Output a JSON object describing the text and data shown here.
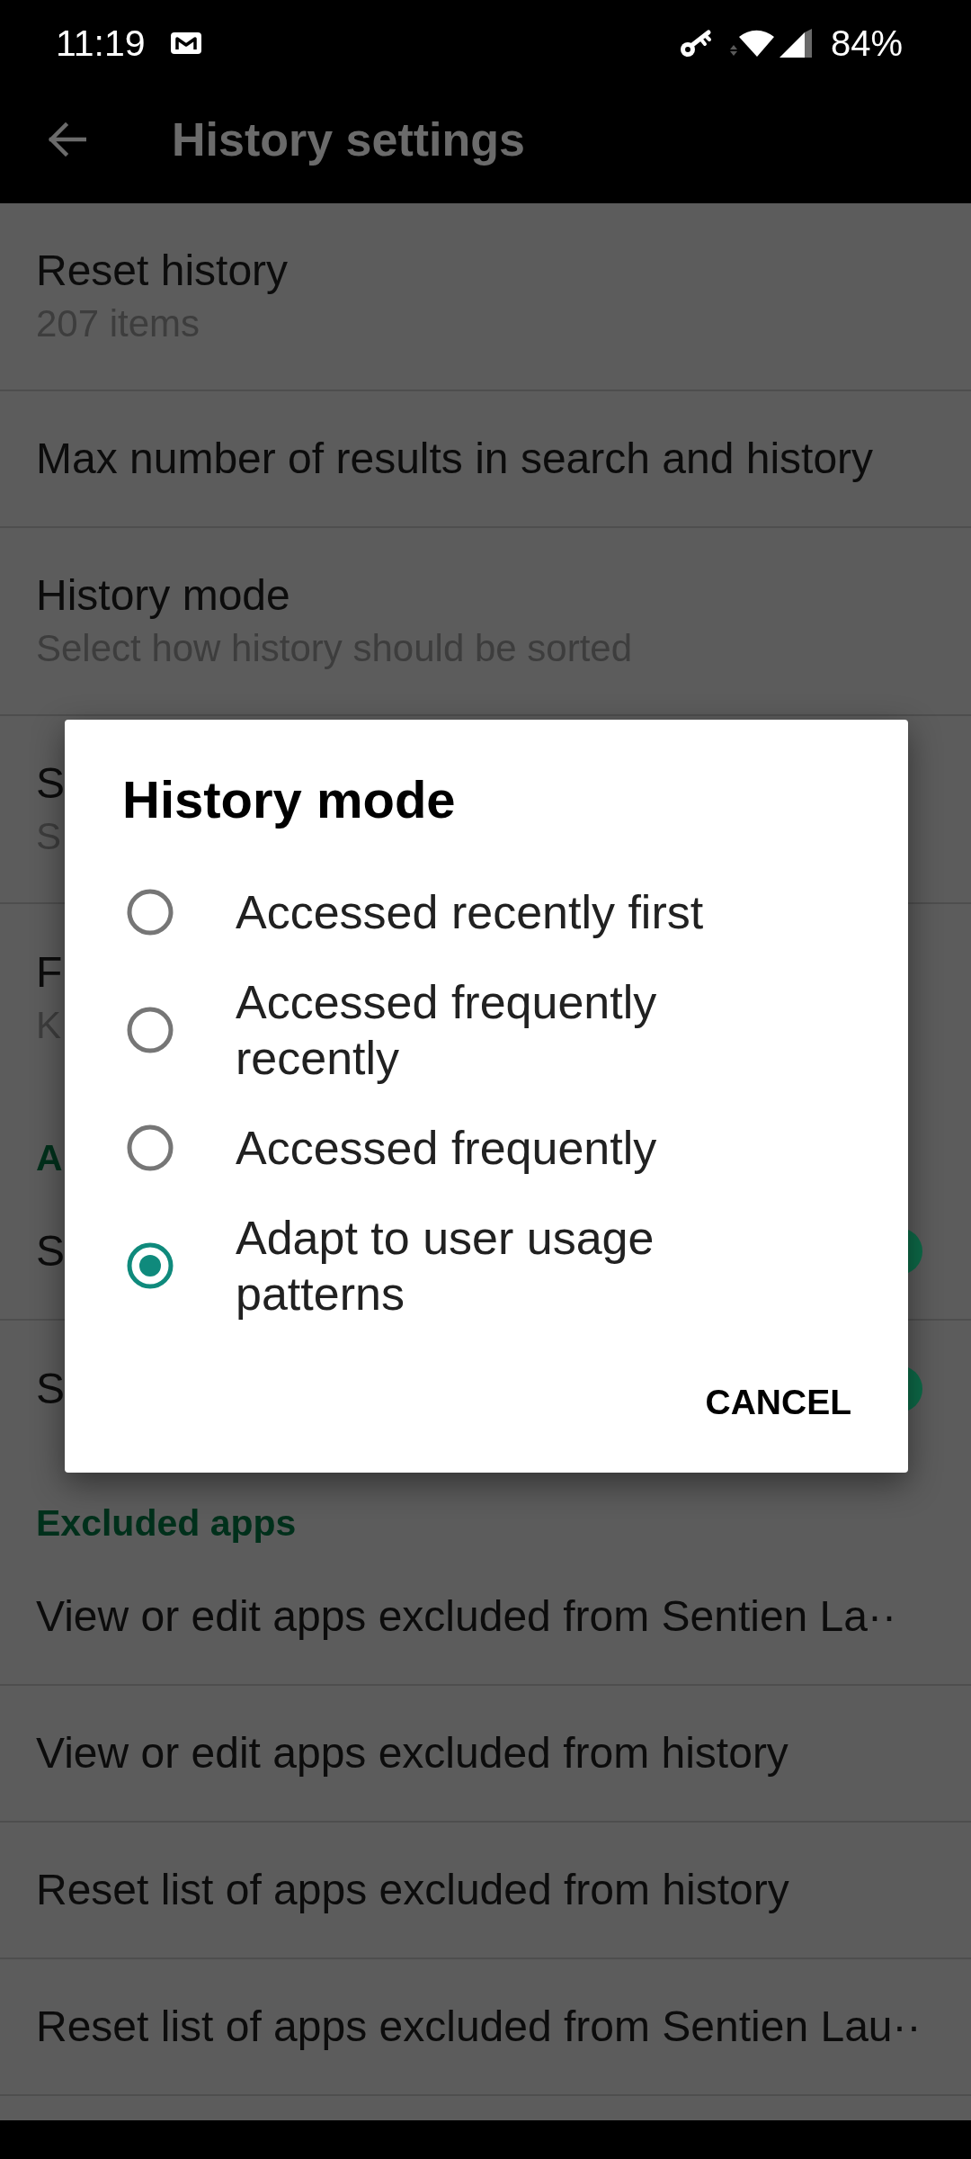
{
  "status_bar": {
    "time": "11:19",
    "battery": "84%"
  },
  "app_bar": {
    "title": "History settings"
  },
  "settings": [
    {
      "kind": "item",
      "title": "Reset history",
      "summary": "207 items"
    },
    {
      "kind": "item",
      "title": "Max number of results in search and history"
    },
    {
      "kind": "item",
      "title": "History mode",
      "summary": "Select how history should be sorted"
    },
    {
      "kind": "item",
      "title": "S",
      "summary": "S"
    },
    {
      "kind": "item",
      "title": "F",
      "summary": "K"
    },
    {
      "kind": "category",
      "title": "A"
    },
    {
      "kind": "switch",
      "title": "S",
      "on": true
    },
    {
      "kind": "switch",
      "title": "S",
      "on": true
    },
    {
      "kind": "category",
      "title": "Excluded apps"
    },
    {
      "kind": "item",
      "title": "View or edit apps excluded from Sentien La··"
    },
    {
      "kind": "item",
      "title": "View or edit apps excluded from history"
    },
    {
      "kind": "item",
      "title": "Reset list of apps excluded from history"
    },
    {
      "kind": "item",
      "title": "Reset list of apps excluded from Sentien Lau··"
    }
  ],
  "dialog": {
    "title": "History mode",
    "options": [
      {
        "label": "Accessed recently first",
        "selected": false
      },
      {
        "label": "Accessed frequently recently",
        "selected": false
      },
      {
        "label": "Accessed frequently",
        "selected": false
      },
      {
        "label": "Adapt to user usage patterns",
        "selected": true
      }
    ],
    "buttons": [
      "CANCEL"
    ]
  }
}
